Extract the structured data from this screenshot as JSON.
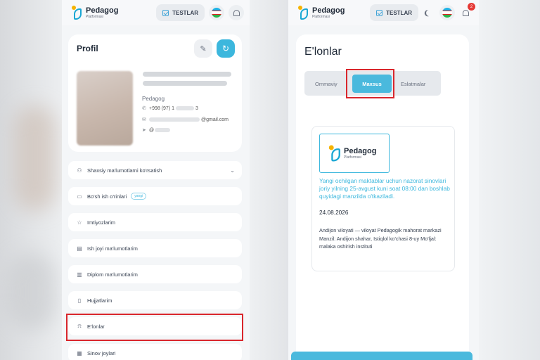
{
  "left": {
    "header": {
      "brand": "Pedagog",
      "brand_sub": "Platformasi",
      "tests_label": "TESTLAR"
    },
    "profile": {
      "title": "Profil",
      "role": "Pedagog",
      "phone": "+998 (97) 1",
      "phone_tail": "3",
      "email_domain": "@gmail.com",
      "telegram_prefix": "@"
    },
    "menu": [
      {
        "label": "Shaxsiy ma'lumotlarni ko'rsatish",
        "icon": "user-icon"
      },
      {
        "label": "Bo'sh ish o'rinlari",
        "icon": "briefcase-icon",
        "tag": "yangi"
      },
      {
        "label": "Imtiyozlarim",
        "icon": "star-icon"
      },
      {
        "label": "Ish joyi ma'lumotlarim",
        "icon": "building-icon"
      },
      {
        "label": "Diplom ma'lumotlarim",
        "icon": "diploma-icon"
      },
      {
        "label": "Hujjatlarim",
        "icon": "document-icon"
      },
      {
        "label": "E'lonlar",
        "icon": "bell-icon"
      },
      {
        "label": "Sinov joylari",
        "icon": "map-icon"
      }
    ]
  },
  "right": {
    "header": {
      "brand": "Pedagog",
      "brand_sub": "Platformasi",
      "tests_label": "TESTLAR",
      "notification_count": "2"
    },
    "title": "E'lonlar",
    "tabs": [
      "Ommaviy",
      "Maxsus",
      "Eslatmalar"
    ],
    "active_tab": "Maxsus",
    "announcement": {
      "logo_brand": "Pedagog",
      "logo_sub": "Platformasi",
      "headline": "Yangi ochilgan maktablar uchun nazorat sinovlari joriy yilning 25-avgust kuni soat 08:00 dan boshlab quyidagi manzilda o'tkaziladi.",
      "date": "24.08.2026",
      "body": "Andijon viloyati — viloyat Pedagogik mahorat markazi Manzil: Andijon shahar, Istiqlol ko'chasi 8-uy Mo'ljal: malaka oshirish instituti"
    }
  },
  "colors": {
    "accent": "#3cb7dd",
    "highlight": "#d9262c"
  }
}
